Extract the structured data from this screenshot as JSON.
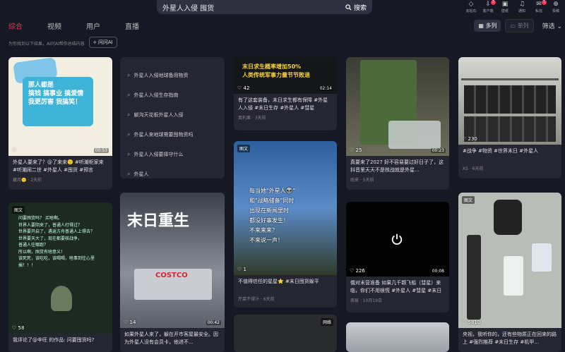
{
  "search": {
    "query": "外星人入侵 囤货",
    "button": "搜索"
  },
  "top_icons": [
    {
      "label": "充钻石",
      "icon": "diamond-icon",
      "glyph": "◇",
      "badge": ""
    },
    {
      "label": "客户端",
      "icon": "download-icon",
      "glyph": "⇩",
      "badge": "2"
    },
    {
      "label": "壁纸",
      "icon": "wallpaper-icon",
      "glyph": "▣",
      "badge": ""
    },
    {
      "label": "通知",
      "icon": "bell-icon",
      "glyph": "♫",
      "badge": ""
    },
    {
      "label": "私信",
      "icon": "message-icon",
      "glyph": "✉",
      "badge": "1"
    },
    {
      "label": "投稿",
      "icon": "upload-icon",
      "glyph": "⊕",
      "badge": ""
    }
  ],
  "tabs": [
    "综合",
    "视频",
    "用户",
    "直播"
  ],
  "view": {
    "multi": "多列",
    "single": "单列",
    "filter": "筛选"
  },
  "hint": "为你找到以下结果，AI问AI帮你总结内容",
  "ai_ask": "问问AI",
  "related": [
    "外星人入侵地球备用物资",
    "外星人入侵生存指南",
    "躺沟天花板外星人入侵",
    "外星人来地球需要囤物资吗",
    "外星人入侵要择守什么",
    "外星人"
  ],
  "cards": [
    {
      "likes": "",
      "dur": "00:53",
      "tag": "",
      "desc": "外星人要来了？@了来来🙂 #听潮柜家来 #听潮闹二世 #外星人 #囤货 #预言",
      "meta": "藏月🙂 · 2天前",
      "thumb_text": "那人都是\n搞钱 搞事业 搞爱情\n我更厉害 我搞笑！"
    },
    {
      "likes": "42",
      "dur": "02:14",
      "tag": "",
      "desc": "有了这套装备，末日求生都有保障 #外星人入侵 #末日生存 #外星人 #彗星",
      "meta": "真利果 · 3天前",
      "thumb_text": "末日求生概率增加50%\n人类传统军事力量节节败退"
    },
    {
      "likes": "25",
      "dur": "00:23",
      "tag": "",
      "desc": "真要来了2027 好不容易要过好日子了，这抖音里天天不是核战就是外星...",
      "meta": "底来 · 5天前",
      "thumb_text": ""
    },
    {
      "likes": "230",
      "dur": "",
      "tag": "",
      "desc": "#战争 #物资 #世界末日 #外星人",
      "meta": "X5 · 6天前",
      "thumb_text": ""
    },
    {
      "likes": "58",
      "dur": "",
      "tag": "图文",
      "desc": "我评论了@辛旺 的作品: 问要囤货吗?",
      "meta": "",
      "thumb_text": "问要囤货吗？ 买啥啊。\n世界人要阴来了，普通人打得过？\n世界要开启了，遇返方舟普通人上得去？\n世界要天大了，现在都要核战争，\n普通人往哪跑？\n所以啊，囤货有啥意义！\n该死死，该吃吃，该喝喝，啥事到往心里搁！！！"
    },
    {
      "likes": "14",
      "dur": "00:42",
      "tag": "",
      "desc": "如果外星人来了，躲在开市客屋最安全。因为外星人没有会员卡，他进不...",
      "meta": "",
      "thumb_text": "末日重生"
    },
    {
      "likes": "1",
      "dur": "",
      "tag": "图文",
      "desc": "不值得信任的星星⭐ #末日囤货躲平",
      "meta": "芹菜不得汁 · 6天前",
      "thumb_text": "每当她\"外星人👽\"\n和\"战略储备\"同时\n出现在新闻里时\n都没好事发生！\n不来来来？\n不来说一声！"
    },
    {
      "likes": "226",
      "dur": "00:08",
      "tag": "",
      "desc": "俄对末营准备 如果几千颗飞船（彗星）来临，你们不用很慌 #外星人 #彗星 #末日",
      "meta": "周易 · 10月19日",
      "thumb_text": ""
    },
    {
      "likes": "5810",
      "dur": "",
      "tag": "图文",
      "desc": "央视，我听你的，还有些物质正在回来的路上 #强烈推荐 #末日生存 #机甲...",
      "meta": "",
      "thumb_text": ""
    },
    {
      "likes": "",
      "dur": "",
      "tag": "网络",
      "desc": "",
      "meta": "",
      "thumb_text": ""
    },
    {
      "likes": "",
      "dur": "",
      "tag": "",
      "desc": "",
      "meta": "",
      "thumb_text": ""
    }
  ]
}
